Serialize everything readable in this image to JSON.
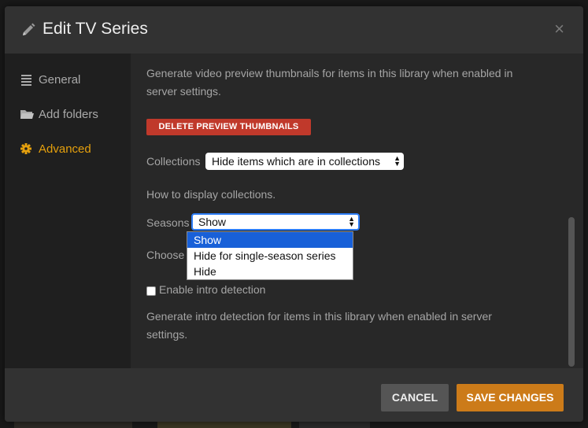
{
  "modal": {
    "title": "Edit TV Series",
    "close_glyph": "×"
  },
  "sidebar": {
    "items": [
      {
        "label": "General",
        "icon": "list-icon",
        "active": false
      },
      {
        "label": "Add folders",
        "icon": "folder-icon",
        "active": false
      },
      {
        "label": "Advanced",
        "icon": "gear-icon",
        "active": true
      }
    ]
  },
  "content": {
    "thumbnails_help_line1": "Generate video preview thumbnails for items in this library when enabled in",
    "thumbnails_help_line2": "server settings.",
    "delete_thumbnails_label": "DELETE PREVIEW THUMBNAILS",
    "collections_label": "Collections",
    "collections_value": "Hide items which are in collections",
    "collections_help": "How to display collections.",
    "seasons_label": "Seasons",
    "seasons_value": "Show",
    "seasons_options": [
      "Show",
      "Hide for single-season series",
      "Hide"
    ],
    "seasons_help_partial": "Choose w",
    "intro_label": "Enable intro detection",
    "intro_help_line1": "Generate intro detection for items in this library when enabled in server",
    "intro_help_line2": "settings."
  },
  "footer": {
    "cancel_label": "CANCEL",
    "save_label": "SAVE CHANGES"
  },
  "colors": {
    "accent": "#e5a00d",
    "danger": "#c0392b",
    "save": "#cc7b19",
    "select_highlight": "#1860d8"
  }
}
